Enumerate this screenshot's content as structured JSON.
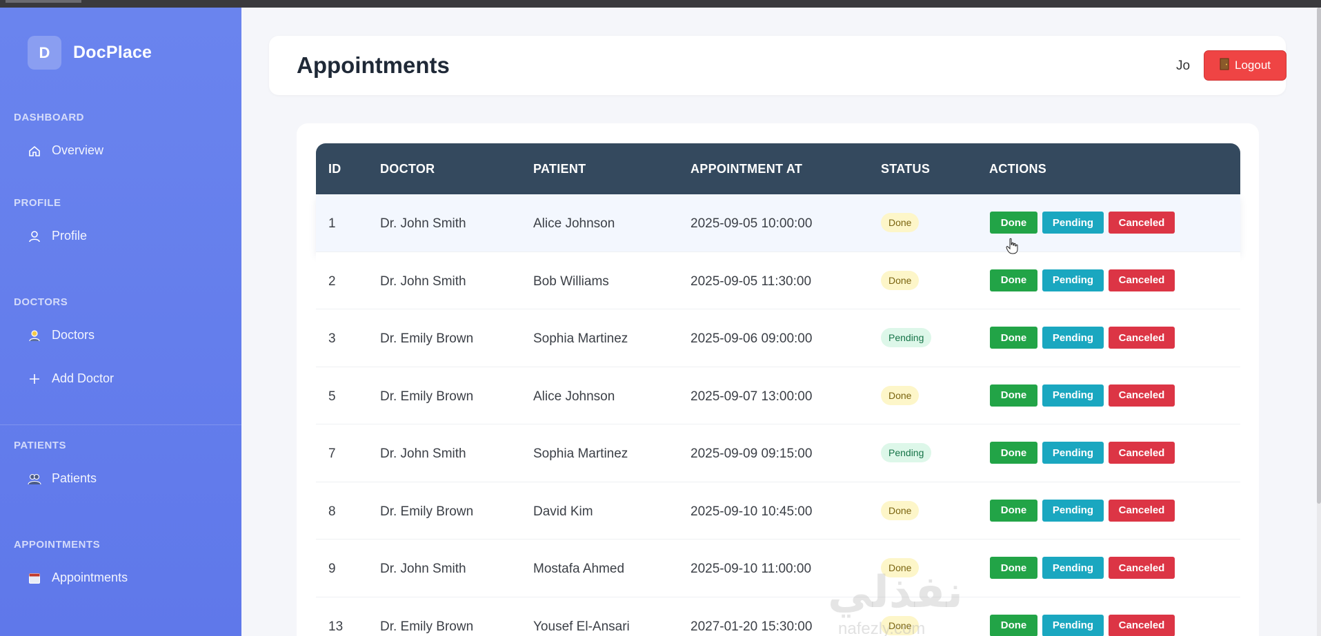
{
  "brand": {
    "badge": "D",
    "name": "DocPlace"
  },
  "sidebar": {
    "sections": [
      {
        "title": "DASHBOARD",
        "items": [
          {
            "label": "Overview",
            "icon": "home-icon"
          }
        ]
      },
      {
        "title": "PROFILE",
        "items": [
          {
            "label": "Profile",
            "icon": "user-icon"
          }
        ]
      },
      {
        "title": "DOCTORS",
        "items": [
          {
            "label": "Doctors",
            "icon": "doctor-icon"
          },
          {
            "label": "Add Doctor",
            "icon": "plus-icon"
          }
        ]
      },
      {
        "title": "PATIENTS",
        "items": [
          {
            "label": "Patients",
            "icon": "patients-icon"
          }
        ]
      },
      {
        "title": "APPOINTMENTS",
        "items": [
          {
            "label": "Appointments",
            "icon": "calendar-icon"
          }
        ]
      }
    ]
  },
  "header": {
    "title": "Appointments",
    "user": "Jo",
    "logout_label": "Logout"
  },
  "table": {
    "columns": [
      "ID",
      "DOCTOR",
      "PATIENT",
      "APPOINTMENT AT",
      "STATUS",
      "ACTIONS"
    ],
    "action_labels": {
      "done": "Done",
      "pending": "Pending",
      "canceled": "Canceled"
    },
    "rows": [
      {
        "id": "1",
        "doctor": "Dr. John Smith",
        "patient": "Alice Johnson",
        "at": "2025-09-05 10:00:00",
        "status": "Done"
      },
      {
        "id": "2",
        "doctor": "Dr. John Smith",
        "patient": "Bob Williams",
        "at": "2025-09-05 11:30:00",
        "status": "Done"
      },
      {
        "id": "3",
        "doctor": "Dr. Emily Brown",
        "patient": "Sophia Martinez",
        "at": "2025-09-06 09:00:00",
        "status": "Pending"
      },
      {
        "id": "5",
        "doctor": "Dr. Emily Brown",
        "patient": "Alice Johnson",
        "at": "2025-09-07 13:00:00",
        "status": "Done"
      },
      {
        "id": "7",
        "doctor": "Dr. John Smith",
        "patient": "Sophia Martinez",
        "at": "2025-09-09 09:15:00",
        "status": "Pending"
      },
      {
        "id": "8",
        "doctor": "Dr. Emily Brown",
        "patient": "David Kim",
        "at": "2025-09-10 10:45:00",
        "status": "Done"
      },
      {
        "id": "9",
        "doctor": "Dr. John Smith",
        "patient": "Mostafa Ahmed",
        "at": "2025-09-10 11:00:00",
        "status": "Done"
      },
      {
        "id": "13",
        "doctor": "Dr. Emily Brown",
        "patient": "Yousef El-Ansari",
        "at": "2027-01-20 15:30:00",
        "status": "Done"
      }
    ]
  },
  "watermark": {
    "text": "نفذلي",
    "sub": "nafezly.com"
  },
  "colors": {
    "sidebar": "#6a84ee",
    "table_header": "#34495e",
    "done": "#22a447",
    "pending": "#1aa7c0",
    "canceled": "#dc3545",
    "logout": "#ef4444"
  }
}
